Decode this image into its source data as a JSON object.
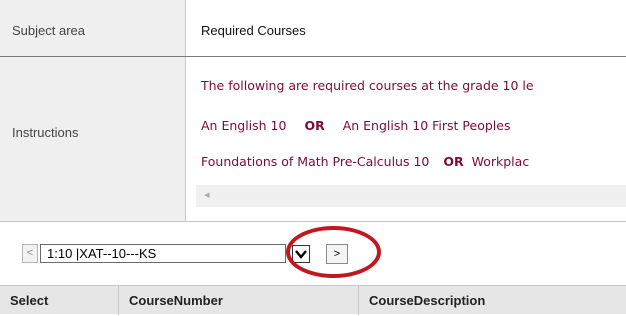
{
  "info": {
    "subject": {
      "label": "Subject area",
      "value": "Required Courses"
    },
    "instructions": {
      "label": "Instructions",
      "line1": "The following are required courses at the grade 10 le",
      "line2": {
        "a": "An English 10",
        "or": "OR",
        "b": "An English 10 First Peoples"
      },
      "line3": {
        "a": "Foundations of Math Pre-Calculus 10",
        "or": "OR",
        "b": "Workplac"
      }
    }
  },
  "pager": {
    "prev_label": "<",
    "selected": "1:10 |XAT--10---KS",
    "chevron": "⌄",
    "next_label": ">"
  },
  "results": {
    "columns": [
      "Select",
      "CourseNumber",
      "CourseDescription"
    ]
  },
  "icons": {
    "scroll_left": "◂"
  },
  "colors": {
    "highlight": "#c0181d",
    "instruction_text": "#7a0b38"
  }
}
